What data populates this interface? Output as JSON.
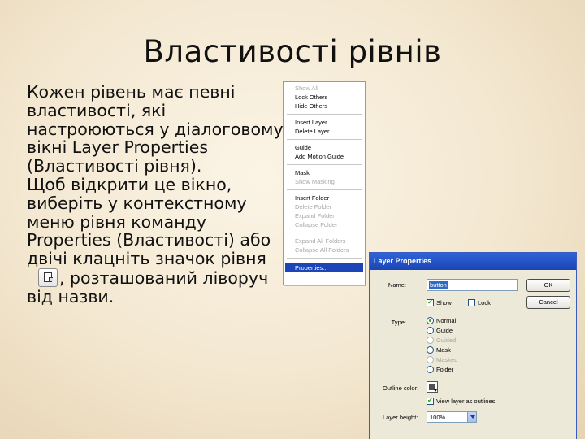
{
  "slide": {
    "title": "Властивості рівнів",
    "paragraph1": "Кожен рівень має певні властивості, які настроюються у діалоговому вікні Layer Properties (Властивості рівня).",
    "paragraph2_before_icon": "Щоб відкрити це вікно, виберіть у контекстному меню рівня команду Properties (Властивості) або двічі клацніть значок рівня",
    "paragraph2_after_icon": ", розташований ліворуч від назви.",
    "icon": "layer-page-icon"
  },
  "context_menu": {
    "groups": [
      [
        {
          "label": "Show All",
          "enabled": false
        },
        {
          "label": "Lock Others",
          "enabled": true
        },
        {
          "label": "Hide Others",
          "enabled": true
        }
      ],
      [
        {
          "label": "Insert Layer",
          "enabled": true
        },
        {
          "label": "Delete Layer",
          "enabled": true
        }
      ],
      [
        {
          "label": "Guide",
          "enabled": true
        },
        {
          "label": "Add Motion Guide",
          "enabled": true
        }
      ],
      [
        {
          "label": "Mask",
          "enabled": true
        },
        {
          "label": "Show Masking",
          "enabled": false
        }
      ],
      [
        {
          "label": "Insert Folder",
          "enabled": true
        },
        {
          "label": "Delete Folder",
          "enabled": false
        },
        {
          "label": "Expand Folder",
          "enabled": false
        },
        {
          "label": "Collapse Folder",
          "enabled": false
        }
      ],
      [
        {
          "label": "Expand All Folders",
          "enabled": false
        },
        {
          "label": "Collapse All Folders",
          "enabled": false
        }
      ],
      [
        {
          "label": "Properties...",
          "enabled": true,
          "selected": true
        }
      ]
    ]
  },
  "dialog": {
    "title": "Layer Properties",
    "name_label": "Name:",
    "name_value": "button",
    "ok_label": "OK",
    "cancel_label": "Cancel",
    "show_label": "Show",
    "show_checked": true,
    "lock_label": "Lock",
    "lock_checked": false,
    "type_label": "Type:",
    "type_options": [
      {
        "label": "Normal",
        "checked": true,
        "enabled": true
      },
      {
        "label": "Guide",
        "checked": false,
        "enabled": true
      },
      {
        "label": "Guided",
        "checked": false,
        "enabled": false
      },
      {
        "label": "Mask",
        "checked": false,
        "enabled": true
      },
      {
        "label": "Masked",
        "checked": false,
        "enabled": false
      },
      {
        "label": "Folder",
        "checked": false,
        "enabled": true
      }
    ],
    "outline_color_label": "Outline color:",
    "outline_color": "#505050",
    "view_outlines_label": "View layer as outlines",
    "view_outlines_checked": true,
    "layer_height_label": "Layer height:",
    "layer_height_value": "100%"
  },
  "colors": {
    "menu_highlight": "#1c46b8",
    "title_bar": "#2f63d8",
    "dialog_bg": "#ece9d8"
  }
}
